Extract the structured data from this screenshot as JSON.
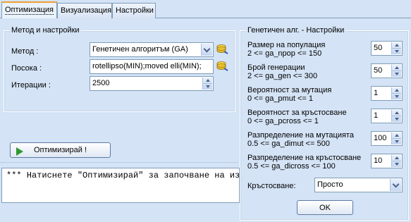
{
  "tabs": [
    {
      "label": "Оптимизация",
      "active": true
    },
    {
      "label": "Визуализация",
      "active": false
    },
    {
      "label": "Настройки",
      "active": false
    }
  ],
  "method_group": {
    "title": "Метод и настройки",
    "method_label": "Метод :",
    "method_value": "Генетичен алгоритъм (GA)",
    "direction_label": "Посока :",
    "direction_value": "rotellipso(MIN);moved elli(MIN);",
    "iterations_label": "Итерации :",
    "iterations_value": "2500"
  },
  "optimize_button": "Оптимизирай !",
  "output_text": "*** Натиснете \"Оптимизирай\" за започване на изч",
  "ga_group": {
    "title": "Генетичен алг. - Настройки",
    "params": [
      {
        "label": "Размер на популация",
        "range": "2 <= ga_npop <= 150",
        "value": "50"
      },
      {
        "label": "Брой генерации",
        "range": "2 <= ga_gen <= 300",
        "value": "50"
      },
      {
        "label": "Вероятност за мутация",
        "range": "0 <= ga_pmut <= 1",
        "value": "1"
      },
      {
        "label": "Вероятност за кръстосване",
        "range": "0 <= ga_pcross <= 1",
        "value": "1"
      },
      {
        "label": "Разпределение на мутацията",
        "range": "0.5 <= ga_dimut <= 500",
        "value": "100"
      },
      {
        "label": "Разпределение на кръстосване",
        "range": "0.5 <= ga_dicross <= 100",
        "value": "10"
      }
    ],
    "crossover_label": "Кръстосване:",
    "crossover_value": "Просто",
    "ok_button": "OK"
  },
  "icons": {
    "db": "database-icon",
    "play": "play-icon"
  },
  "colors": {
    "background": "#d4e3f5",
    "border": "#7f9db9",
    "active_tab_accent": "#f0a030",
    "play_green": "#2e9a2e"
  }
}
